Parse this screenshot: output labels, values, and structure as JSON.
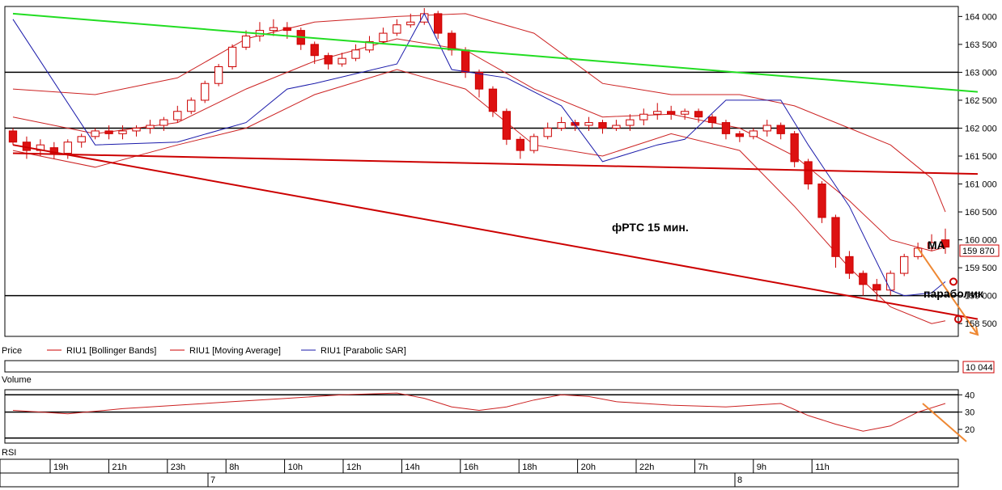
{
  "chart_data": {
    "type": "candlestick",
    "annotation_title": "фРТС   15 мин.",
    "annotation_ma": "MA",
    "annotation_sar": "параболик",
    "price_axis": {
      "ylim": [
        158300,
        164150
      ],
      "ticks": [
        "164 000",
        "163 500",
        "163 000",
        "162 500",
        "162 000",
        "161 500",
        "161 000",
        "160 500",
        "160 000",
        "159 500",
        "159 000",
        "158 500"
      ],
      "tick_values": [
        164000,
        163500,
        163000,
        162500,
        162000,
        161500,
        161000,
        160500,
        160000,
        159500,
        159000,
        158500
      ],
      "last_price_label": "159 870",
      "last_price": 159870,
      "label_left": "Price",
      "horizontal_levels": [
        163000,
        162000,
        159000
      ]
    },
    "legend": [
      "RIU1 [Bollinger Bands]",
      "RIU1 [Moving Average]",
      "RIU1 [Parabolic SAR]"
    ],
    "candles": [
      [
        161950,
        161750,
        162000,
        161700
      ],
      [
        161750,
        161600,
        161850,
        161450
      ],
      [
        161600,
        161700,
        161800,
        161500
      ],
      [
        161650,
        161550,
        161750,
        161450
      ],
      [
        161550,
        161750,
        161800,
        161450
      ],
      [
        161750,
        161850,
        161900,
        161650
      ],
      [
        161850,
        161950,
        162000,
        161800
      ],
      [
        161950,
        161900,
        162050,
        161800
      ],
      [
        161900,
        161950,
        162050,
        161800
      ],
      [
        161950,
        162000,
        162050,
        161850
      ],
      [
        162000,
        162050,
        162150,
        161900
      ],
      [
        162050,
        162150,
        162200,
        161950
      ],
      [
        162150,
        162300,
        162400,
        162100
      ],
      [
        162300,
        162500,
        162550,
        162250
      ],
      [
        162500,
        162800,
        162850,
        162450
      ],
      [
        162800,
        163100,
        163150,
        162750
      ],
      [
        163100,
        163450,
        163500,
        163050
      ],
      [
        163450,
        163650,
        163750,
        163400
      ],
      [
        163650,
        163750,
        163900,
        163550
      ],
      [
        163750,
        163800,
        163950,
        163650
      ],
      [
        163800,
        163750,
        163900,
        163600
      ],
      [
        163750,
        163500,
        163800,
        163400
      ],
      [
        163500,
        163300,
        163550,
        163150
      ],
      [
        163300,
        163150,
        163350,
        163050
      ],
      [
        163150,
        163250,
        163350,
        163100
      ],
      [
        163250,
        163400,
        163500,
        163200
      ],
      [
        163400,
        163550,
        163650,
        163350
      ],
      [
        163550,
        163700,
        163800,
        163500
      ],
      [
        163700,
        163850,
        163950,
        163650
      ],
      [
        163850,
        163900,
        164050,
        163800
      ],
      [
        163900,
        164050,
        164150,
        163850
      ],
      [
        164050,
        163700,
        164100,
        163600
      ],
      [
        163700,
        163400,
        163750,
        163300
      ],
      [
        163400,
        163000,
        163450,
        162900
      ],
      [
        163000,
        162700,
        163050,
        162550
      ],
      [
        162700,
        162300,
        162750,
        162200
      ],
      [
        162300,
        161800,
        162350,
        161700
      ],
      [
        161800,
        161600,
        161850,
        161450
      ],
      [
        161600,
        161850,
        161900,
        161550
      ],
      [
        161850,
        162000,
        162100,
        161800
      ],
      [
        162000,
        162100,
        162200,
        161950
      ],
      [
        162100,
        162050,
        162150,
        161950
      ],
      [
        162050,
        162100,
        162200,
        161950
      ],
      [
        162100,
        162000,
        162150,
        161900
      ],
      [
        162000,
        162050,
        162150,
        161950
      ],
      [
        162050,
        162150,
        162250,
        161950
      ],
      [
        162150,
        162250,
        162350,
        162050
      ],
      [
        162250,
        162300,
        162450,
        162150
      ],
      [
        162300,
        162250,
        162400,
        162150
      ],
      [
        162250,
        162300,
        162350,
        162150
      ],
      [
        162300,
        162200,
        162350,
        162100
      ],
      [
        162200,
        162100,
        162250,
        162000
      ],
      [
        162100,
        161900,
        162150,
        161800
      ],
      [
        161900,
        161850,
        161950,
        161750
      ],
      [
        161850,
        161950,
        162000,
        161800
      ],
      [
        161950,
        162050,
        162150,
        161850
      ],
      [
        162050,
        161900,
        162100,
        161800
      ],
      [
        161900,
        161400,
        161950,
        161300
      ],
      [
        161400,
        161000,
        161450,
        160900
      ],
      [
        161000,
        160400,
        161050,
        160300
      ],
      [
        160400,
        159700,
        160450,
        159500
      ],
      [
        159700,
        159400,
        159800,
        159300
      ],
      [
        159400,
        159200,
        159450,
        159000
      ],
      [
        159200,
        159100,
        159300,
        158900
      ],
      [
        159100,
        159400,
        159450,
        159000
      ],
      [
        159400,
        159700,
        159750,
        159350
      ],
      [
        159700,
        159850,
        159950,
        159650
      ],
      [
        159850,
        159950,
        160100,
        159800
      ],
      [
        160000,
        159870,
        160200,
        159750
      ]
    ],
    "moving_average": [
      [
        0,
        162200
      ],
      [
        6,
        161900
      ],
      [
        12,
        162100
      ],
      [
        17,
        162700
      ],
      [
        22,
        163200
      ],
      [
        28,
        163600
      ],
      [
        33,
        163400
      ],
      [
        38,
        162700
      ],
      [
        43,
        162200
      ],
      [
        48,
        162250
      ],
      [
        53,
        162000
      ],
      [
        57,
        161500
      ],
      [
        61,
        160700
      ],
      [
        64,
        160000
      ],
      [
        67,
        159800
      ],
      [
        68,
        159870
      ]
    ],
    "bollinger_upper": [
      [
        0,
        162700
      ],
      [
        6,
        162600
      ],
      [
        12,
        162900
      ],
      [
        17,
        163600
      ],
      [
        22,
        163900
      ],
      [
        28,
        164000
      ],
      [
        33,
        164050
      ],
      [
        38,
        163700
      ],
      [
        43,
        162800
      ],
      [
        48,
        162600
      ],
      [
        53,
        162600
      ],
      [
        57,
        162400
      ],
      [
        61,
        162000
      ],
      [
        64,
        161700
      ],
      [
        67,
        161100
      ],
      [
        68,
        160500
      ]
    ],
    "bollinger_lower": [
      [
        0,
        161600
      ],
      [
        6,
        161300
      ],
      [
        12,
        161700
      ],
      [
        17,
        162000
      ],
      [
        22,
        162600
      ],
      [
        28,
        163050
      ],
      [
        33,
        162700
      ],
      [
        38,
        161700
      ],
      [
        43,
        161500
      ],
      [
        48,
        161900
      ],
      [
        53,
        161600
      ],
      [
        57,
        160600
      ],
      [
        61,
        159500
      ],
      [
        64,
        158800
      ],
      [
        67,
        158500
      ],
      [
        68,
        158550
      ]
    ],
    "parabolic_sar": [
      [
        0,
        163950
      ],
      [
        6,
        161700
      ],
      [
        12,
        161750
      ],
      [
        17,
        162100
      ],
      [
        20,
        162700
      ],
      [
        22,
        162800
      ],
      [
        28,
        163150
      ],
      [
        30,
        164050
      ],
      [
        32,
        163050
      ],
      [
        36,
        162900
      ],
      [
        40,
        162400
      ],
      [
        43,
        161400
      ],
      [
        47,
        161700
      ],
      [
        49,
        161800
      ],
      [
        52,
        162500
      ],
      [
        56,
        162500
      ],
      [
        58,
        161700
      ],
      [
        61,
        160600
      ],
      [
        64,
        159100
      ],
      [
        65,
        159000
      ],
      [
        67,
        159050
      ],
      [
        68,
        159250
      ]
    ],
    "trend_lines": [
      {
        "color": "#22dd22",
        "from": [
          0,
          164050
        ],
        "to": [
          68,
          162650
        ]
      },
      {
        "color": "#cc0000",
        "from": [
          0,
          161550
        ],
        "to": [
          68,
          161180
        ]
      },
      {
        "color": "#cc0000",
        "from": [
          0,
          161700
        ],
        "to": [
          68,
          158580
        ]
      },
      {
        "color": "#ee8833",
        "from": [
          66,
          159850
        ],
        "to": [
          68,
          158300
        ]
      }
    ],
    "volume": {
      "label": "Volume",
      "last_value_label": "10 044"
    },
    "rsi": {
      "label": "RSI",
      "ticks": [
        "40",
        "30",
        "20"
      ],
      "tick_values": [
        40,
        30,
        20
      ],
      "ylim": [
        13,
        42
      ],
      "levels": [
        40,
        30,
        15
      ],
      "values": [
        [
          0,
          31
        ],
        [
          4,
          29
        ],
        [
          8,
          32
        ],
        [
          12,
          34
        ],
        [
          16,
          36
        ],
        [
          20,
          38
        ],
        [
          24,
          40
        ],
        [
          28,
          41
        ],
        [
          30,
          38
        ],
        [
          32,
          33
        ],
        [
          34,
          31
        ],
        [
          36,
          33
        ],
        [
          38,
          37
        ],
        [
          40,
          40
        ],
        [
          42,
          39
        ],
        [
          44,
          36
        ],
        [
          48,
          34
        ],
        [
          52,
          33
        ],
        [
          56,
          35
        ],
        [
          58,
          28
        ],
        [
          60,
          23
        ],
        [
          62,
          19
        ],
        [
          64,
          22
        ],
        [
          66,
          30
        ],
        [
          68,
          35
        ]
      ]
    },
    "time_axis": {
      "labels": [
        "19h",
        "21h",
        "23h",
        "8h",
        "10h",
        "12h",
        "14h",
        "16h",
        "18h",
        "20h",
        "22h",
        "7h",
        "9h",
        "11h"
      ],
      "days": [
        "7",
        "8"
      ]
    }
  }
}
